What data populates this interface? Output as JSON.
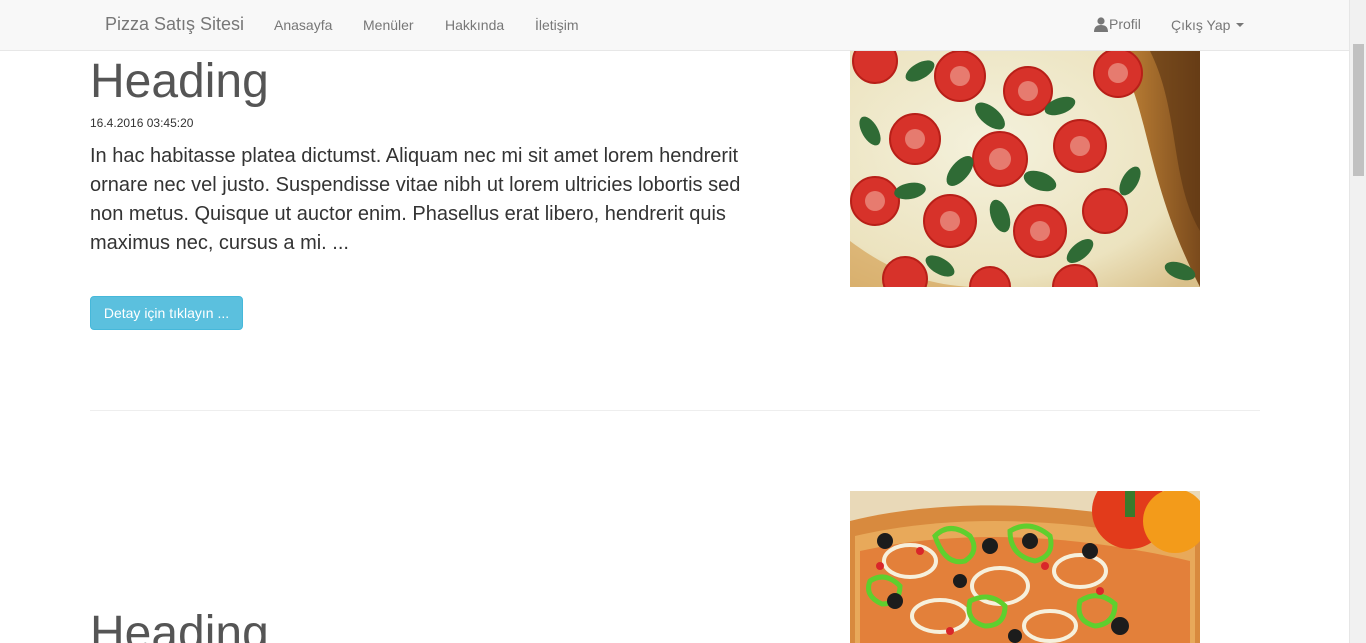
{
  "nav": {
    "brand": "Pizza Satış Sitesi",
    "links": [
      "Anasayfa",
      "Menüler",
      "Hakkında",
      "İletişim"
    ],
    "profile": "Profil",
    "logout": "Çıkış Yap"
  },
  "articles": [
    {
      "heading": "Heading",
      "date": "16.4.2016 03:45:20",
      "text": "In hac habitasse platea dictumst. Aliquam nec mi sit amet lorem hendrerit ornare nec vel justo. Suspendisse vitae nibh ut lorem ultricies lobortis sed non metus. Quisque ut auctor enim. Phasellus erat libero, hendrerit quis maximus nec, cursus a mi. ...",
      "button": "Detay için tıklayın ..."
    },
    {
      "heading": "Heading"
    }
  ],
  "colors": {
    "navbar_bg": "#f8f8f8",
    "button_bg": "#5bc0de",
    "heading": "#555555"
  }
}
